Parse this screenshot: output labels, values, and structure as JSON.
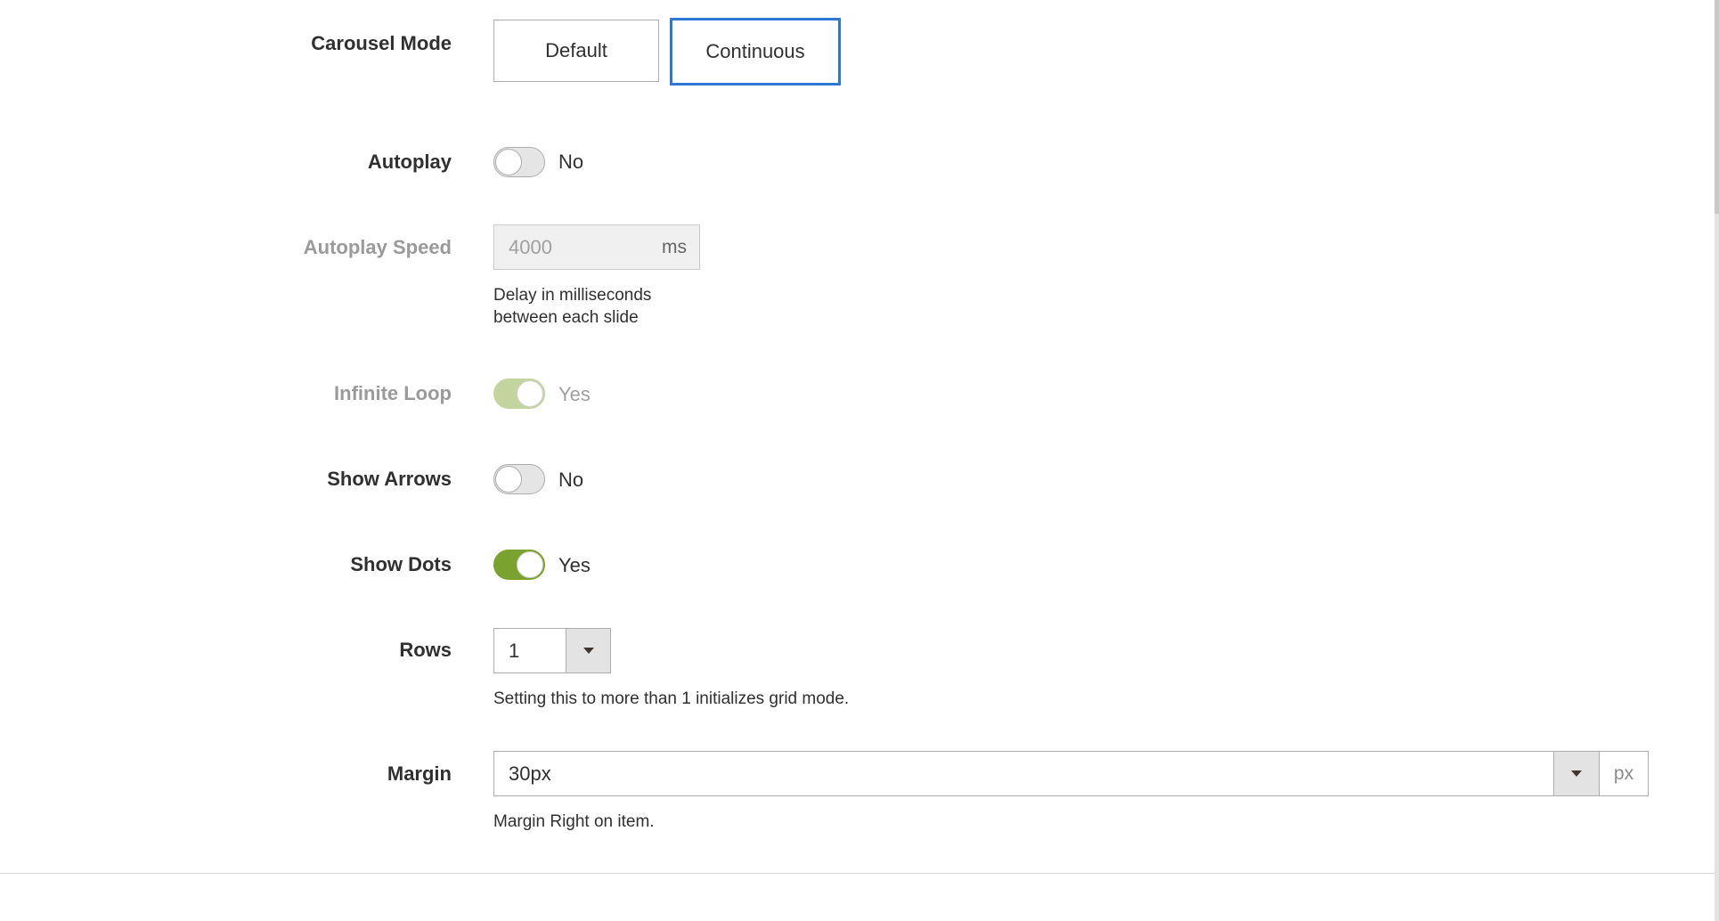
{
  "carousel_mode": {
    "label": "Carousel Mode",
    "options": [
      {
        "label": "Default",
        "selected": false
      },
      {
        "label": "Continuous",
        "selected": true
      }
    ]
  },
  "autoplay": {
    "label": "Autoplay",
    "value": false,
    "state_text": "No"
  },
  "autoplay_speed": {
    "label": "Autoplay Speed",
    "value": "4000",
    "unit": "ms",
    "note_line1": "Delay in milliseconds",
    "note_line2": "between each slide",
    "disabled": true
  },
  "infinite_loop": {
    "label": "Infinite Loop",
    "value": true,
    "state_text": "Yes",
    "disabled": true
  },
  "show_arrows": {
    "label": "Show Arrows",
    "value": false,
    "state_text": "No"
  },
  "show_dots": {
    "label": "Show Dots",
    "value": true,
    "state_text": "Yes"
  },
  "rows": {
    "label": "Rows",
    "value": "1",
    "note": "Setting this to more than 1 initializes grid mode."
  },
  "margin": {
    "label": "Margin",
    "value": "30px",
    "unit": "px",
    "note": "Margin Right on item."
  },
  "colors": {
    "selected_border": "#2d78d2",
    "toggle_on": "#79a22e",
    "toggle_on_disabled": "#c4d49e",
    "text": "#303030",
    "disabled_text": "#9a9a9a"
  },
  "icons": {
    "select_arrow": "caret-down-icon",
    "toggle_knob": "toggle-knob-icon"
  }
}
